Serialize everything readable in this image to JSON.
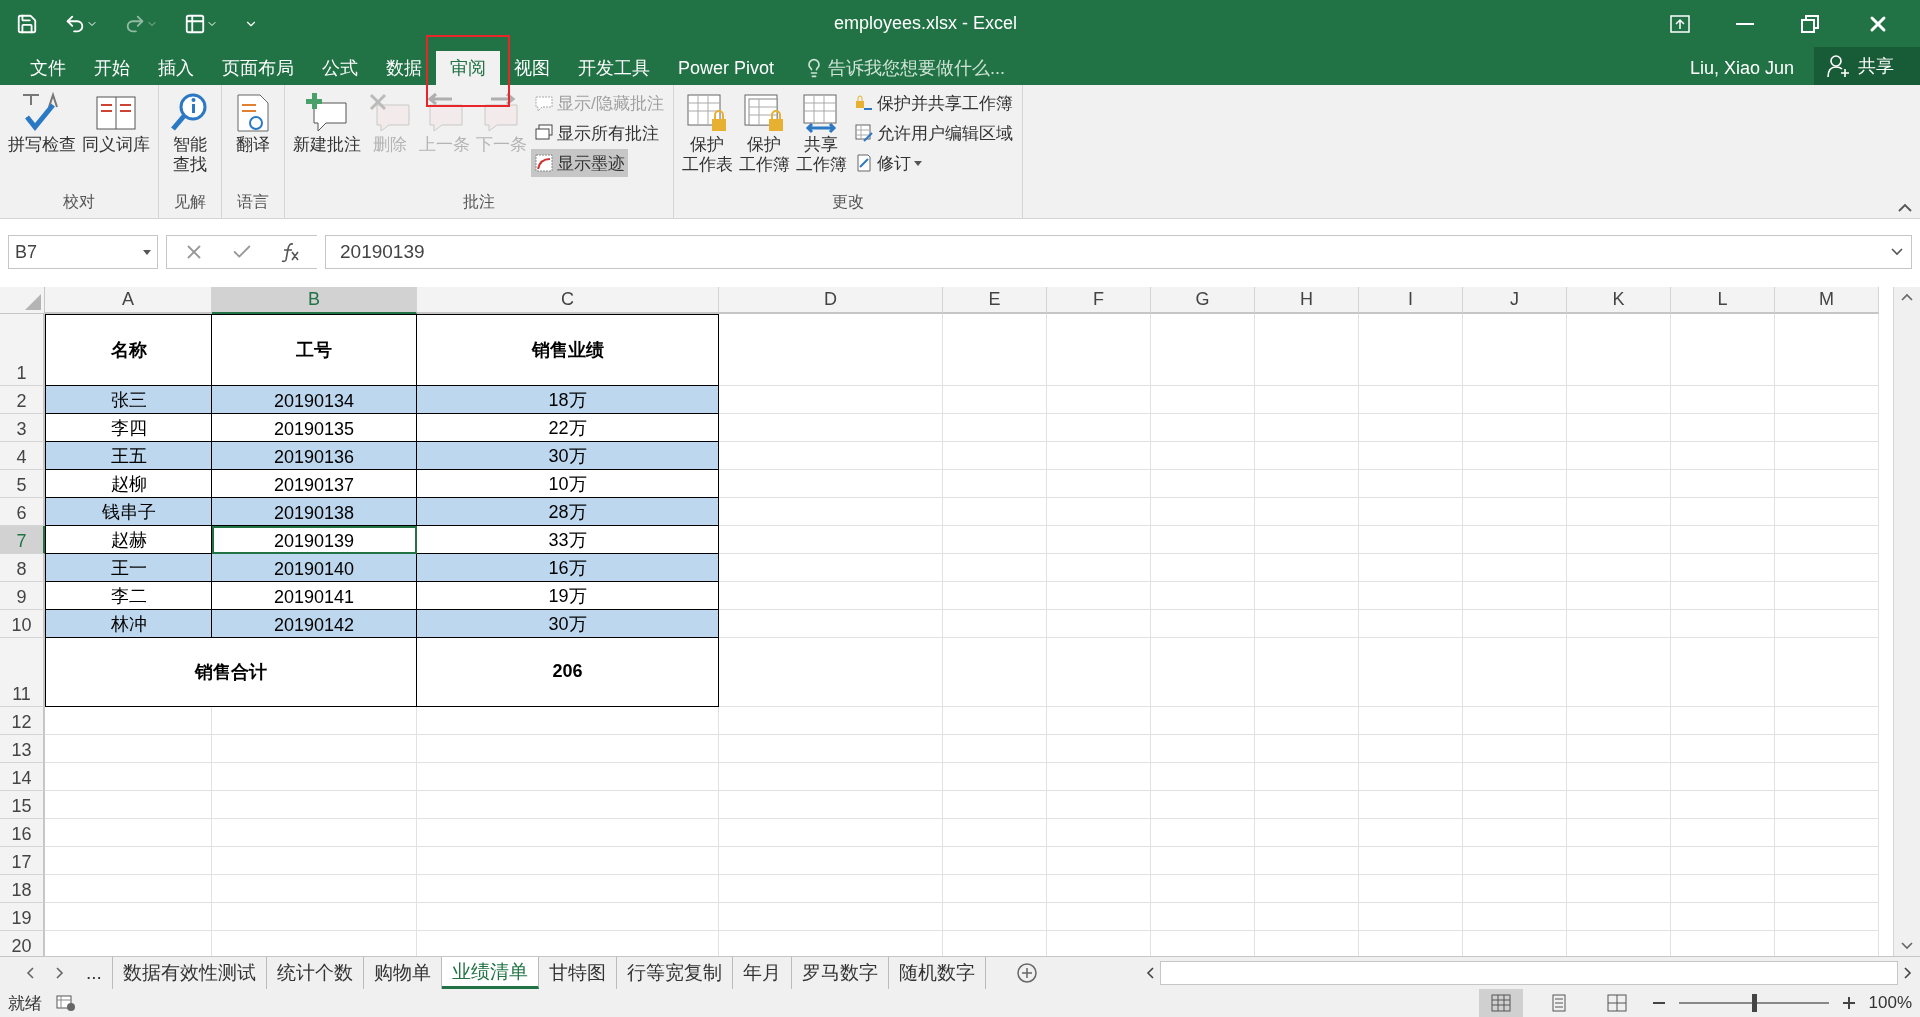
{
  "window": {
    "title": "employees.xlsx - Excel"
  },
  "menu_tabs": [
    {
      "label": "文件",
      "selected": false,
      "annotated": false
    },
    {
      "label": "开始",
      "selected": false,
      "annotated": false
    },
    {
      "label": "插入",
      "selected": false,
      "annotated": false
    },
    {
      "label": "页面布局",
      "selected": false,
      "annotated": false
    },
    {
      "label": "公式",
      "selected": false,
      "annotated": false
    },
    {
      "label": "数据",
      "selected": false,
      "annotated": false
    },
    {
      "label": "审阅",
      "selected": true,
      "annotated": true
    },
    {
      "label": "视图",
      "selected": false,
      "annotated": false
    },
    {
      "label": "开发工具",
      "selected": false,
      "annotated": false
    },
    {
      "label": "Power Pivot",
      "selected": false,
      "annotated": false
    }
  ],
  "tell_me": {
    "placeholder": "告诉我您想要做什么..."
  },
  "user": "Liu, Xiao Jun",
  "share": "共享",
  "ribbon_groups": [
    {
      "label": "校对",
      "buttons": [
        {
          "kind": "large",
          "label_lines": [
            "拼写检查"
          ],
          "disabled": false
        },
        {
          "kind": "large",
          "label_lines": [
            "同义词库"
          ],
          "disabled": false
        }
      ]
    },
    {
      "label": "见解",
      "buttons": [
        {
          "kind": "large",
          "label_lines": [
            "智能",
            "查找"
          ],
          "disabled": false
        }
      ]
    },
    {
      "label": "语言",
      "buttons": [
        {
          "kind": "large",
          "label_lines": [
            "翻译"
          ],
          "disabled": false
        }
      ]
    },
    {
      "label": "批注",
      "buttons": [
        {
          "kind": "large",
          "label_lines": [
            "新建批注"
          ],
          "disabled": false
        },
        {
          "kind": "large",
          "label_lines": [
            "删除"
          ],
          "disabled": true
        },
        {
          "kind": "large",
          "label_lines": [
            "上一条"
          ],
          "disabled": true
        },
        {
          "kind": "large",
          "label_lines": [
            "下一条"
          ],
          "disabled": true
        },
        {
          "kind": "small",
          "label_lines": [
            "显示/隐藏批注"
          ],
          "disabled": true,
          "active": false
        },
        {
          "kind": "small",
          "label_lines": [
            "显示所有批注"
          ],
          "disabled": false,
          "active": false
        },
        {
          "kind": "small",
          "label_lines": [
            "显示墨迹"
          ],
          "disabled": false,
          "active": true
        }
      ]
    },
    {
      "label": "更改",
      "buttons": [
        {
          "kind": "large",
          "label_lines": [
            "保护",
            "工作表"
          ],
          "disabled": false
        },
        {
          "kind": "large",
          "label_lines": [
            "保护",
            "工作簿"
          ],
          "disabled": false
        },
        {
          "kind": "large",
          "label_lines": [
            "共享",
            "工作簿"
          ],
          "disabled": false
        },
        {
          "kind": "small",
          "label_lines": [
            "保护并共享工作簿"
          ],
          "disabled": false,
          "active": false
        },
        {
          "kind": "small",
          "label_lines": [
            "允许用户编辑区域"
          ],
          "disabled": false,
          "active": false
        },
        {
          "kind": "dropdown",
          "label_lines": [
            "修订"
          ],
          "disabled": false,
          "active": false
        }
      ]
    }
  ],
  "formula_bar": {
    "name_box": "B7",
    "value": "20190139"
  },
  "columns": [
    {
      "label": "A",
      "selected": false
    },
    {
      "label": "B",
      "selected": true
    },
    {
      "label": "C",
      "selected": false
    },
    {
      "label": "D",
      "selected": false
    },
    {
      "label": "E",
      "selected": false
    },
    {
      "label": "F",
      "selected": false
    },
    {
      "label": "G",
      "selected": false
    },
    {
      "label": "H",
      "selected": false
    },
    {
      "label": "I",
      "selected": false
    },
    {
      "label": "J",
      "selected": false
    },
    {
      "label": "K",
      "selected": false
    },
    {
      "label": "L",
      "selected": false
    },
    {
      "label": "M",
      "selected": false
    }
  ],
  "header_row": {
    "number": "1",
    "cells": [
      "名称",
      "工号",
      "销售业绩"
    ]
  },
  "rows": [
    {
      "number": "2",
      "shaded": true,
      "cells": [
        {
          "text": "张三",
          "selected": false
        },
        {
          "text": "20190134",
          "selected": false
        },
        {
          "text": "18万",
          "selected": false
        }
      ]
    },
    {
      "number": "3",
      "shaded": false,
      "cells": [
        {
          "text": "李四",
          "selected": false
        },
        {
          "text": "20190135",
          "selected": false
        },
        {
          "text": "22万",
          "selected": false
        }
      ]
    },
    {
      "number": "4",
      "shaded": true,
      "cells": [
        {
          "text": "王五",
          "selected": false
        },
        {
          "text": "20190136",
          "selected": false
        },
        {
          "text": "30万",
          "selected": false
        }
      ]
    },
    {
      "number": "5",
      "shaded": false,
      "cells": [
        {
          "text": "赵柳",
          "selected": false
        },
        {
          "text": "20190137",
          "selected": false
        },
        {
          "text": "10万",
          "selected": false
        }
      ]
    },
    {
      "number": "6",
      "shaded": true,
      "cells": [
        {
          "text": "钱串子",
          "selected": false
        },
        {
          "text": "20190138",
          "selected": false
        },
        {
          "text": "28万",
          "selected": false
        }
      ]
    },
    {
      "number": "7",
      "shaded": false,
      "cells": [
        {
          "text": "赵赫",
          "selected": false
        },
        {
          "text": "20190139",
          "selected": true
        },
        {
          "text": "33万",
          "selected": false
        }
      ]
    },
    {
      "number": "8",
      "shaded": true,
      "cells": [
        {
          "text": "王一",
          "selected": false
        },
        {
          "text": "20190140",
          "selected": false
        },
        {
          "text": "16万",
          "selected": false
        }
      ]
    },
    {
      "number": "9",
      "shaded": false,
      "cells": [
        {
          "text": "李二",
          "selected": false
        },
        {
          "text": "20190141",
          "selected": false
        },
        {
          "text": "19万",
          "selected": false
        }
      ]
    },
    {
      "number": "10",
      "shaded": true,
      "cells": [
        {
          "text": "林冲",
          "selected": false
        },
        {
          "text": "20190142",
          "selected": false
        },
        {
          "text": "30万",
          "selected": false
        }
      ]
    }
  ],
  "total_row": {
    "number": "11",
    "label": "销售合计",
    "value": "206"
  },
  "empty_rows": [
    "12",
    "13",
    "14",
    "15",
    "16",
    "17",
    "18",
    "19",
    "20"
  ],
  "sheet_tabs": [
    {
      "label": "数据有效性测试",
      "selected": false
    },
    {
      "label": "统计个数",
      "selected": false
    },
    {
      "label": "购物单",
      "selected": false
    },
    {
      "label": "业绩清单",
      "selected": true
    },
    {
      "label": "甘特图",
      "selected": false
    },
    {
      "label": "行等宽复制",
      "selected": false
    },
    {
      "label": "年月",
      "selected": false
    },
    {
      "label": "罗马数字",
      "selected": false
    },
    {
      "label": "随机数字",
      "selected": false
    }
  ],
  "sheet_overflow": "...",
  "status_bar": {
    "status": "就绪",
    "zoom": "100%",
    "zoom_slider": {
      "level": 0.5
    }
  }
}
